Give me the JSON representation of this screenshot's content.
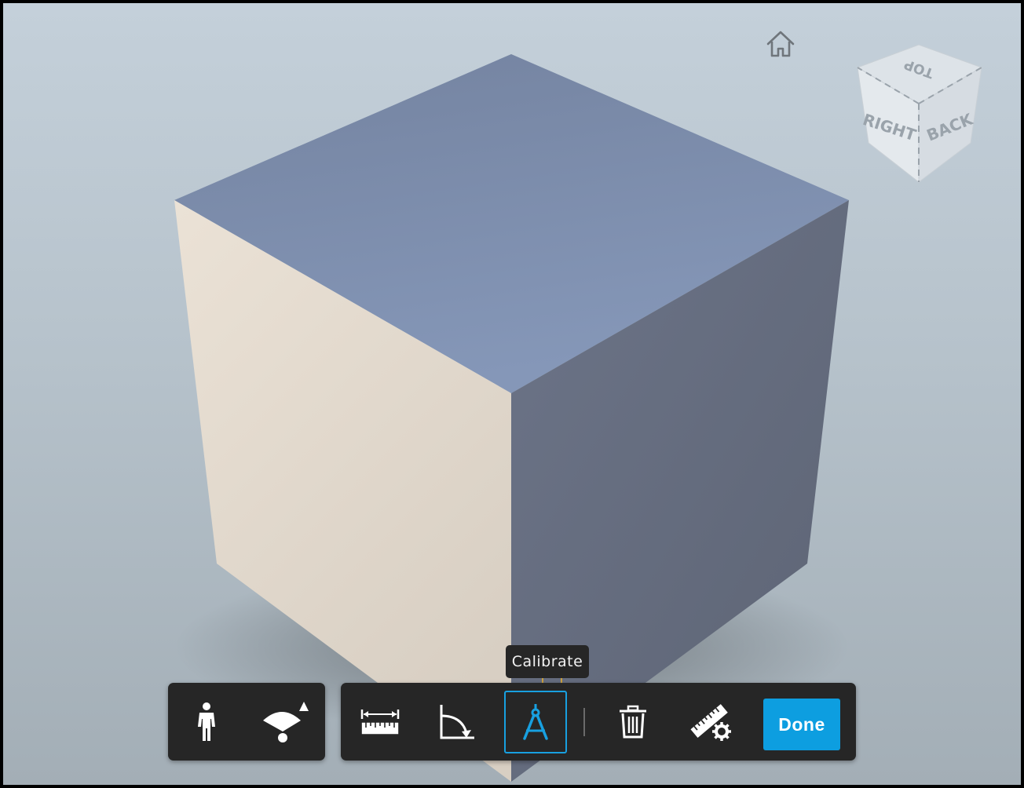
{
  "viewer": {
    "background_top": "#c4d0da",
    "background_bottom": "#a3aeb6",
    "model": "cube"
  },
  "navigation": {
    "home_icon": "home-icon",
    "viewcube": {
      "top_label": "TOP",
      "right_label": "RIGHT",
      "back_label": "BACK"
    }
  },
  "toolbar_left": {
    "items": [
      {
        "icon": "person-icon",
        "name": "first-person"
      },
      {
        "icon": "camera-fov-icon",
        "name": "camera-field-of-view"
      }
    ]
  },
  "toolbar_right": {
    "items": [
      {
        "icon": "ruler-distance-icon",
        "name": "measure-distance"
      },
      {
        "icon": "angle-icon",
        "name": "measure-angle"
      },
      {
        "icon": "compass-calibrate-icon",
        "name": "calibrate",
        "active": true
      },
      {
        "icon": "trash-icon",
        "name": "delete-measurement"
      },
      {
        "icon": "ruler-settings-icon",
        "name": "measure-settings"
      }
    ],
    "done_label": "Done",
    "accent_color": "#0d9ee0"
  },
  "tooltip": {
    "text": "Calibrate"
  }
}
